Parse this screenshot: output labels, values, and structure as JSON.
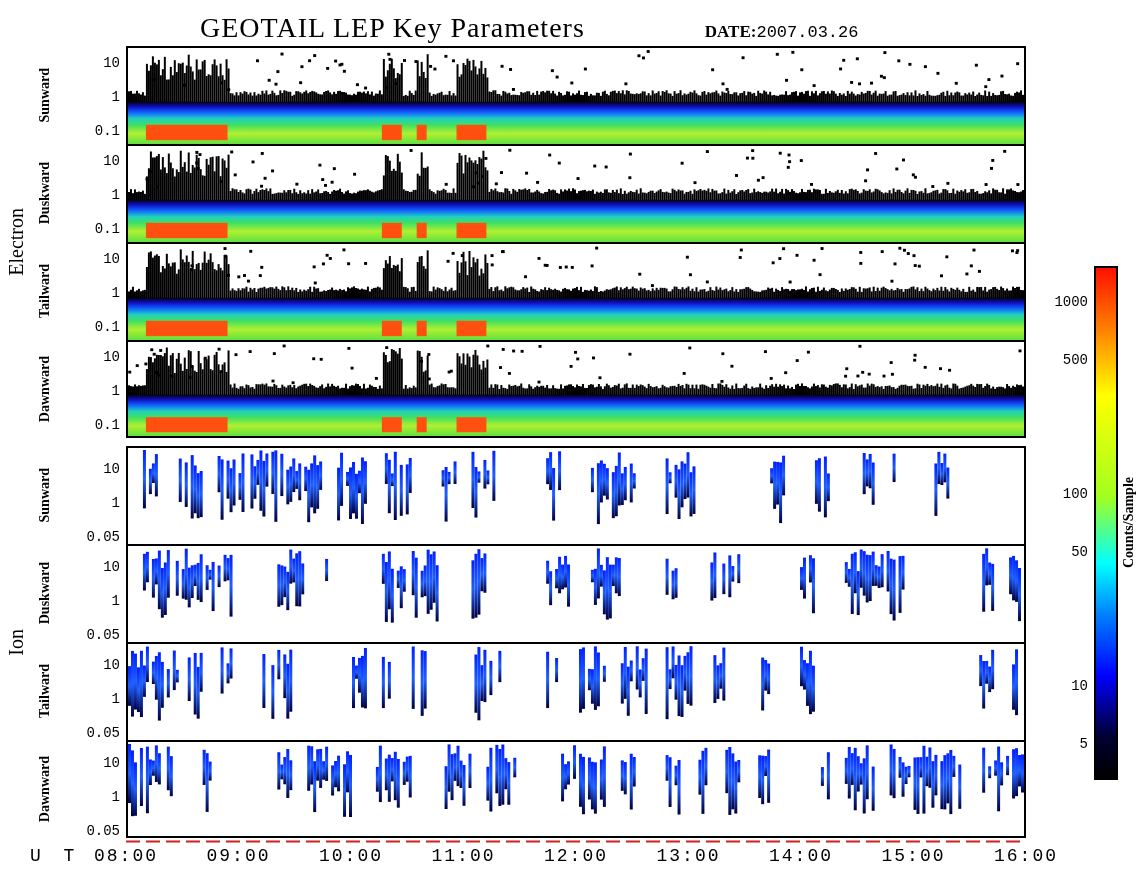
{
  "title": "GEOTAIL LEP Key Parameters",
  "date": {
    "label": "DATE:",
    "value": "2007.03.26"
  },
  "groups": [
    {
      "name": "Electron",
      "kind": "electron",
      "panels": [
        {
          "direction": "Sunward",
          "yticks": [
            "10",
            "1",
            "0.1"
          ]
        },
        {
          "direction": "Duskward",
          "yticks": [
            "10",
            "1",
            "0.1"
          ]
        },
        {
          "direction": "Tailward",
          "yticks": [
            "10",
            "1",
            "0.1"
          ]
        },
        {
          "direction": "Dawnward",
          "yticks": [
            "10",
            "1",
            "0.1"
          ]
        }
      ]
    },
    {
      "name": "Ion",
      "kind": "ion",
      "panels": [
        {
          "direction": "Sunward",
          "yticks": [
            "10",
            "1",
            "0.05"
          ]
        },
        {
          "direction": "Duskward",
          "yticks": [
            "10",
            "1",
            "0.05"
          ]
        },
        {
          "direction": "Tailward",
          "yticks": [
            "10",
            "1",
            "0.05"
          ]
        },
        {
          "direction": "Dawnward",
          "yticks": [
            "10",
            "1",
            "0.05"
          ]
        }
      ]
    }
  ],
  "x_axis": {
    "label": "U T",
    "ticks": [
      "08:00",
      "09:00",
      "10:00",
      "11:00",
      "12:00",
      "13:00",
      "14:00",
      "15:00",
      "16:00"
    ]
  },
  "colorbar": {
    "label": "Counts/Sample",
    "ticks": [
      "1000",
      "500",
      "100",
      "50",
      "10",
      "5"
    ]
  }
}
